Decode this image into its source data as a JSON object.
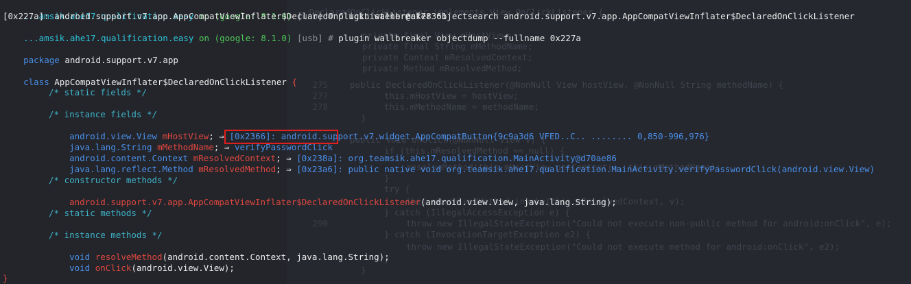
{
  "prompt": {
    "path": "...amsik.ahe17.qualification.easy",
    "on_word": "on",
    "device": "(google: 8.1.0)",
    "transport": "[usb]",
    "hash": "#"
  },
  "commands": [
    "plugin wallbreaker objectsearch android.support.v7.app.AppCompatViewInflater$DeclaredOnClickListener",
    "plugin wallbreaker objectdump --fullname 0x227a"
  ],
  "search_result": "[0x227a]: android.support.v7.app.AppCompatViewInflater$DeclaredOnClickListener@cf78361",
  "dump": {
    "package_kw": "package",
    "package_name": "android.support.v7.app",
    "class_kw": "class",
    "class_name": "AppCompatViewInflater$DeclaredOnClickListener",
    "open_brace": "{",
    "close_brace": "}",
    "arrow": "⇒",
    "comments": {
      "static_fields": "/* static fields */",
      "instance_fields": "/* instance fields */",
      "constructor_methods": "/* constructor methods */",
      "static_methods": "/* static methods */",
      "instance_methods": "/* instance methods */"
    },
    "fields": [
      {
        "type": "android.view.View",
        "name": "mHostView",
        "value_id": "[0x2366]:",
        "value": "android.support.v7.widget.AppCompatButton{9c9a3d6 VFED..C.. ........ 0,850-996,976}"
      },
      {
        "type": "java.lang.String",
        "name": "mMethodName",
        "value_id": "",
        "value": "verifyPasswordClick"
      },
      {
        "type": "android.content.Context",
        "name": "mResolvedContext",
        "value_id": "[0x238a]:",
        "value": "org.teamsik.ahe17.qualification.MainActivity@d70ae86"
      },
      {
        "type": "java.lang.reflect.Method",
        "name": "mResolvedMethod",
        "value_id": "[0x23a6]:",
        "value": "public native void org.teamsik.ahe17.qualification.MainActivity.verifyPasswordClick(android.view.View)"
      }
    ],
    "constructor": {
      "name": "android.support.v7.app.AppCompatViewInflater$DeclaredOnClickListener",
      "args": "(android.view.View, java.lang.String);"
    },
    "methods": [
      {
        "ret": "void",
        "name": "resolveMethod",
        "args": "(android.content.Context, java.lang.String);"
      },
      {
        "ret": "void",
        "name": "onClick",
        "args": "(android.view.View);"
      }
    ]
  },
  "background": {
    "lines": [
      "...DeclaredOnClickListener implements View.OnClickListener {",
      "private final View mHostView;",
      "private final String mMethodName;",
      "private Context mResolvedContext;",
      "private Method mResolvedMethod;",
      "public DeclaredOnClickListener(@NonNull View hostView, @NonNull String methodName) {",
      "this.mHostView = hostView;",
      "this.mMethodName = methodName;",
      "}",
      "public void onClick(@NonNull View v) {",
      "if (this.mResolvedMethod == null) {",
      "resolveMethod(this.mHostView.getContext(), this.mMethodName);",
      "}",
      "try {",
      "this.mResolvedMethod.invoke(this.mResolvedContext, v);",
      "} catch (IllegalAccessException e) {",
      "throw new IllegalStateException(\"Could not execute non-public method for android:onClick\", e);",
      "} catch (InvocationTargetException e2) {",
      "throw new IllegalStateException(\"Could not execute method for android:onClick\", e2);",
      "}",
      "}"
    ],
    "line_numbers": [
      "275",
      "277",
      "278",
      "290"
    ]
  }
}
